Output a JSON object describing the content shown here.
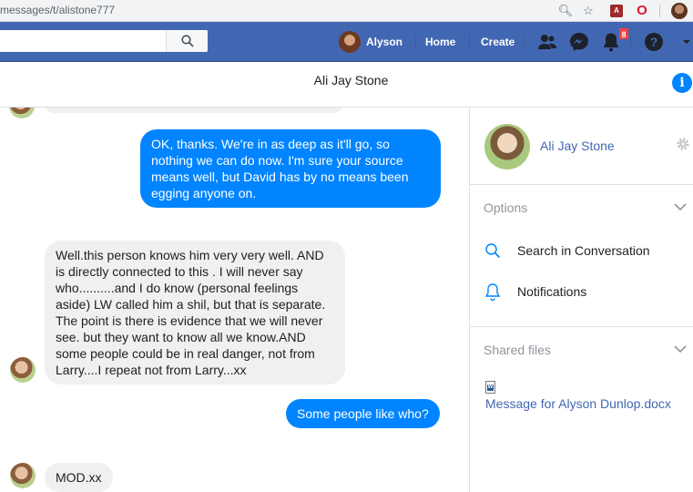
{
  "browser": {
    "url": "messages/t/alistone777"
  },
  "navbar": {
    "search_placeholder": "",
    "user_name": "Alyson",
    "home_label": "Home",
    "create_label": "Create",
    "notifications_count": "8"
  },
  "conversation": {
    "title": "Ali Jay Stone"
  },
  "messages": [
    {
      "direction": "outgoing",
      "text": "OK, thanks. We're in as deep as it'll go, so nothing we can do now.  I'm sure your source means well, but David has by no means been egging anyone on."
    },
    {
      "direction": "incoming",
      "text": "Well.this person knows him very very well. AND is directly connected to this . I will never say who..........and I do know (personal feelings aside) LW called him a shil, but that is separate. The point is there is evidence that we will never see. but they want to know all we know.AND some people could be in real danger, not from Larry....I repeat not from Larry...xx"
    },
    {
      "direction": "outgoing",
      "text": "Some people like who?"
    },
    {
      "direction": "incoming",
      "text": "MOD.xx"
    }
  ],
  "sidebar": {
    "contact_name": "Ali Jay Stone",
    "options_label": "Options",
    "options": [
      {
        "label": "Search in Conversation",
        "icon": "search-icon"
      },
      {
        "label": "Notifications",
        "icon": "bell-icon"
      }
    ],
    "shared_files_label": "Shared files",
    "files": [
      {
        "name": "Message for Alyson Dunlop.docx",
        "icon": "word-doc-icon"
      }
    ]
  },
  "colors": {
    "facebook_blue": "#4267b2",
    "messenger_blue": "#0084ff",
    "incoming_bubble": "#f1f0f0"
  }
}
